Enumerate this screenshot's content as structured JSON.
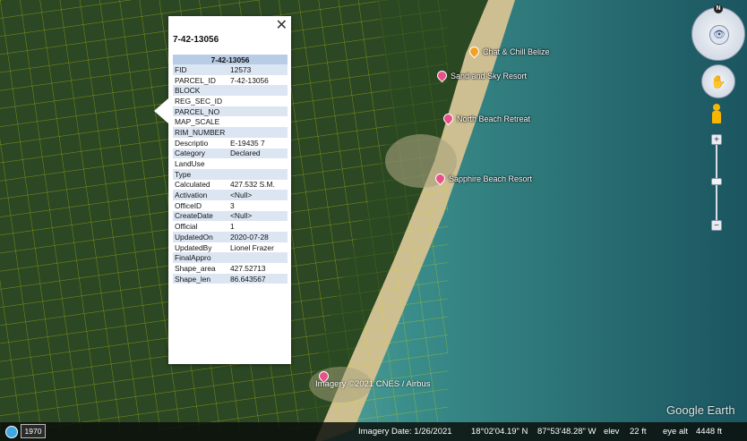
{
  "popup": {
    "title": "7-42-13056",
    "close_glyph": "✕",
    "table_header": "7-42-13056",
    "rows": [
      {
        "key": "FID",
        "value": "12573"
      },
      {
        "key": "PARCEL_ID",
        "value": "7-42-13056"
      },
      {
        "key": "BLOCK",
        "value": ""
      },
      {
        "key": "REG_SEC_ID",
        "value": ""
      },
      {
        "key": "PARCEL_NO",
        "value": ""
      },
      {
        "key": "MAP_SCALE",
        "value": ""
      },
      {
        "key": "RIM_NUMBER",
        "value": ""
      },
      {
        "key": "Descriptio",
        "value": "E-19435 7"
      },
      {
        "key": "Category",
        "value": "Declared"
      },
      {
        "key": "LandUse",
        "value": ""
      },
      {
        "key": "Type",
        "value": ""
      },
      {
        "key": "Calculated",
        "value": "427.532 S.M."
      },
      {
        "key": "Activation",
        "value": "<Null>"
      },
      {
        "key": "OfficeID",
        "value": "3"
      },
      {
        "key": "CreateDate",
        "value": "<Null>"
      },
      {
        "key": "Official",
        "value": "1"
      },
      {
        "key": "UpdatedOn",
        "value": "2020-07-28"
      },
      {
        "key": "UpdatedBy",
        "value": "Lionel Frazer"
      },
      {
        "key": "FinalAppro",
        "value": ""
      },
      {
        "key": "Shape_area",
        "value": "427.52713"
      },
      {
        "key": "Shape_len",
        "value": "86.643567"
      }
    ]
  },
  "places": [
    {
      "name": "Chat & Chill Belize",
      "icon": "orange-pin-icon"
    },
    {
      "name": "Sand and Sky Resort",
      "icon": "pink-pin-icon"
    },
    {
      "name": "North Beach Retreat",
      "icon": "pink-pin-icon"
    },
    {
      "name": "Sapphire Beach Resort",
      "icon": "pink-pin-icon"
    },
    {
      "name": "Imagery ©2021 CNES / Airbus",
      "icon": "pink-pin-icon"
    }
  ],
  "nav": {
    "north": "N",
    "look_glyph": "👁",
    "pan_glyph": "✋",
    "zoom_in": "+",
    "zoom_out": "−"
  },
  "brand": "Google Earth",
  "status": {
    "year": "1970",
    "imagery_date": "Imagery Date: 1/26/2021",
    "lat": "18°02'04.19\" N",
    "lon": "87°53'48.28\" W",
    "elev_label": "elev",
    "elev": "22 ft",
    "eye_label": "eye alt",
    "eye_alt": "4448 ft"
  },
  "colors": {
    "parcel_lines": "#d9e000",
    "land": "#2d4a24",
    "sea_shallow": "#3f8f8a",
    "sea_deep": "#1d5a63",
    "sand": "#c9b98a"
  }
}
